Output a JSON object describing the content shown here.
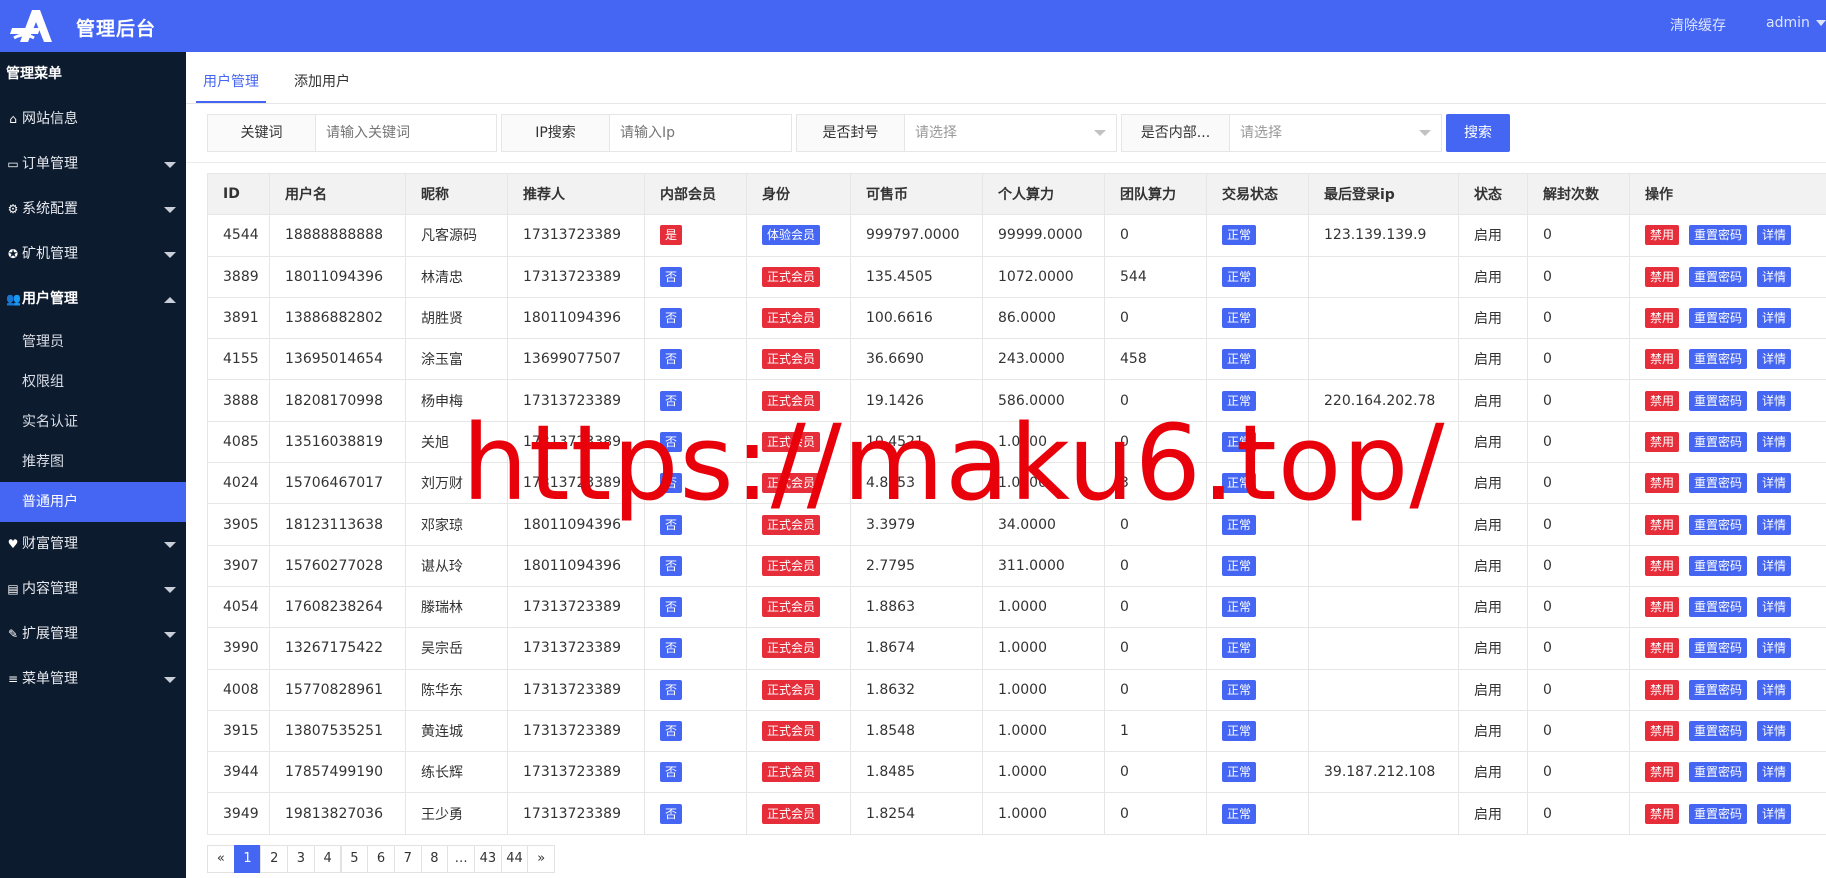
{
  "colors": {
    "header": "#4466f2",
    "sidebar": "#0d1b2e",
    "accent": "#4466f2",
    "danger": "#e62e3b",
    "watermark": "#e8000b"
  },
  "header": {
    "title": "管理后台",
    "clear_cache": "清除缓存",
    "user": "admin"
  },
  "sidebar": {
    "title": "管理菜单",
    "items": [
      {
        "label": "网站信息",
        "icon": "home-icon"
      },
      {
        "label": "订单管理",
        "icon": "credit-card-icon"
      },
      {
        "label": "系统配置",
        "icon": "gears-icon"
      },
      {
        "label": "矿机管理",
        "icon": "rebel-icon"
      },
      {
        "label": "用户管理",
        "icon": "users-icon"
      }
    ],
    "sub_items": [
      "管理员",
      "权限组",
      "实名认证",
      "推荐图",
      "普通用户"
    ],
    "items2": [
      {
        "label": "财富管理",
        "icon": "heartbeat-icon"
      },
      {
        "label": "内容管理",
        "icon": "file-icon"
      },
      {
        "label": "扩展管理",
        "icon": "wrench-icon"
      },
      {
        "label": "菜单管理",
        "icon": "list-icon"
      }
    ]
  },
  "tabs": [
    "用户管理",
    "添加用户"
  ],
  "filters": {
    "keyword": {
      "label": "关键词",
      "placeholder": "请输入关键词"
    },
    "ip": {
      "label": "IP搜索",
      "placeholder": "请输入Ip"
    },
    "banned": {
      "label": "是否封号",
      "placeholder": "请选择"
    },
    "internal": {
      "label": "是否内部...",
      "placeholder": "请选择"
    },
    "search_button": "搜索"
  },
  "table": {
    "columns": [
      "ID",
      "用户名",
      "昵称",
      "推荐人",
      "内部会员",
      "身份",
      "可售币",
      "个人算力",
      "团队算力",
      "交易状态",
      "最后登录ip",
      "状态",
      "解封次数",
      "操作"
    ],
    "actions": [
      "禁用",
      "重置密码",
      "详情"
    ],
    "rows": [
      [
        "4544",
        "18888888888",
        "凡客源码",
        "17313723389",
        "是",
        "体验会员",
        "999797.0000",
        "99999.0000",
        "0",
        "正常",
        "123.139.139.9",
        "启用",
        "0"
      ],
      [
        "3889",
        "18011094396",
        "林清忠",
        "17313723389",
        "否",
        "正式会员",
        "135.4505",
        "1072.0000",
        "544",
        "正常",
        "",
        "启用",
        "0"
      ],
      [
        "3891",
        "13886882802",
        "胡胜贤",
        "18011094396",
        "否",
        "正式会员",
        "100.6616",
        "86.0000",
        "0",
        "正常",
        "",
        "启用",
        "0"
      ],
      [
        "4155",
        "13695014654",
        "涂玉富",
        "13699077507",
        "否",
        "正式会员",
        "36.6690",
        "243.0000",
        "458",
        "正常",
        "",
        "启用",
        "0"
      ],
      [
        "3888",
        "18208170998",
        "杨申梅",
        "17313723389",
        "否",
        "正式会员",
        "19.1426",
        "586.0000",
        "0",
        "正常",
        "220.164.202.78",
        "启用",
        "0"
      ],
      [
        "4085",
        "13516038819",
        "关旭",
        "17313723389",
        "否",
        "正式会员",
        "10.4521",
        "1.0000",
        "0",
        "正常",
        "",
        "启用",
        "0"
      ],
      [
        "4024",
        "15706467017",
        "刘万财",
        "17313723389",
        "否",
        "正式会员",
        "4.8153",
        "1.0000",
        "3",
        "正常",
        "",
        "启用",
        "0"
      ],
      [
        "3905",
        "18123113638",
        "邓家琼",
        "18011094396",
        "否",
        "正式会员",
        "3.3979",
        "34.0000",
        "0",
        "正常",
        "",
        "启用",
        "0"
      ],
      [
        "3907",
        "15760277028",
        "谌从玲",
        "18011094396",
        "否",
        "正式会员",
        "2.7795",
        "311.0000",
        "0",
        "正常",
        "",
        "启用",
        "0"
      ],
      [
        "4054",
        "17608238264",
        "滕瑞林",
        "17313723389",
        "否",
        "正式会员",
        "1.8863",
        "1.0000",
        "0",
        "正常",
        "",
        "启用",
        "0"
      ],
      [
        "3990",
        "13267175422",
        "吴宗岳",
        "17313723389",
        "否",
        "正式会员",
        "1.8674",
        "1.0000",
        "0",
        "正常",
        "",
        "启用",
        "0"
      ],
      [
        "4008",
        "15770828961",
        "陈华东",
        "17313723389",
        "否",
        "正式会员",
        "1.8632",
        "1.0000",
        "0",
        "正常",
        "",
        "启用",
        "0"
      ],
      [
        "3915",
        "13807535251",
        "黄连城",
        "17313723389",
        "否",
        "正式会员",
        "1.8548",
        "1.0000",
        "1",
        "正常",
        "",
        "启用",
        "0"
      ],
      [
        "3944",
        "17857499190",
        "练长辉",
        "17313723389",
        "否",
        "正式会员",
        "1.8485",
        "1.0000",
        "0",
        "正常",
        "39.187.212.108",
        "启用",
        "0"
      ],
      [
        "3949",
        "19813827036",
        "王少勇",
        "17313723389",
        "否",
        "正式会员",
        "1.8254",
        "1.0000",
        "0",
        "正常",
        "",
        "启用",
        "0"
      ]
    ]
  },
  "pagination": [
    "«",
    "1",
    "2",
    "3",
    "4",
    "5",
    "6",
    "7",
    "8",
    "…",
    "43",
    "44",
    "»"
  ],
  "pagination_current": "1",
  "watermark": "https://maku6.top/"
}
